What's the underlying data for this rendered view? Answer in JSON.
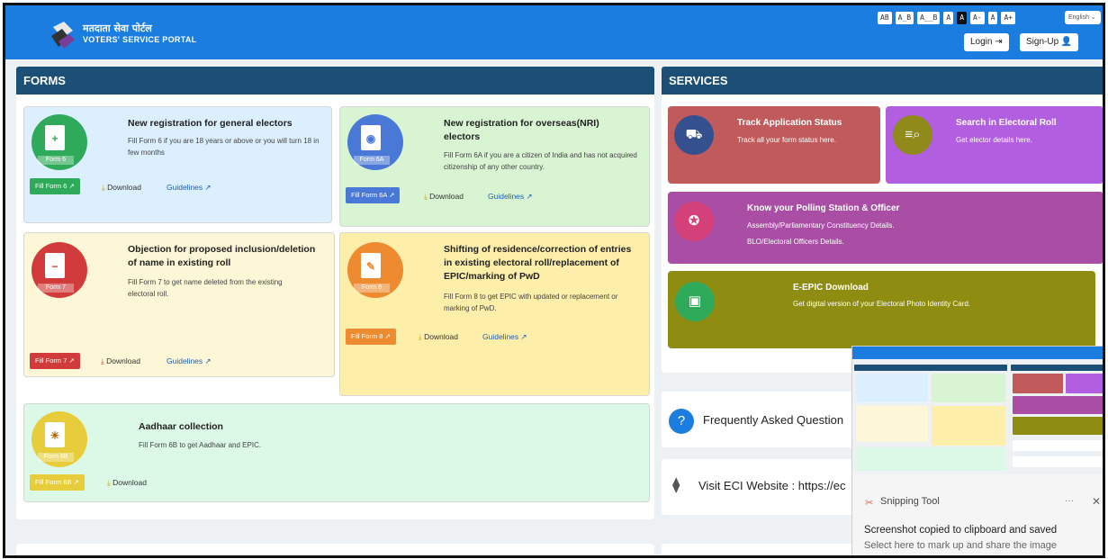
{
  "header": {
    "brand_hindi": "मतदाता सेवा पोर्टल",
    "brand_english": "VOTERS' SERVICE PORTAL",
    "a11y_buttons": [
      "AB",
      "A_B",
      "A__B",
      "A",
      "A",
      "A-",
      "A",
      "A+"
    ],
    "language": "English",
    "login_label": "Login",
    "signup_label": "Sign-Up"
  },
  "forms": {
    "title": "FORMS",
    "cards": [
      {
        "tag": "Form 6",
        "title": "New registration for general electors",
        "desc": "Fill Form 6 if you are 18 years or above or you will turn 18 in few months",
        "fill": "Fill Form 6",
        "download": "Download",
        "guidelines": "Guidelines"
      },
      {
        "tag": "Form 6A",
        "title": "New registration for overseas(NRI) electors",
        "desc": "Fill Form 6A if you are a citizen of India and has not acquired citizenship of any other country.",
        "fill": "Fill Form 6A",
        "download": "Download",
        "guidelines": "Guidelines"
      },
      {
        "tag": "Form 7",
        "title": "Objection for proposed inclusion/deletion of name in existing roll",
        "desc": "Fill Form 7 to get name deleted from the existing electoral roll.",
        "fill": "Fill Form 7",
        "download": "Download",
        "guidelines": "Guidelines"
      },
      {
        "tag": "Form 8",
        "title": "Shifting of residence/correction of entries in existing electoral roll/replacement of EPIC/marking of PwD",
        "desc": "Fill Form 8 to get EPIC with updated or replacement or marking of PwD.",
        "fill": "Fill Form 8",
        "download": "Download",
        "guidelines": "Guidelines"
      },
      {
        "tag": "Form 6B",
        "title": "Aadhaar collection",
        "desc": "Fill Form 6B to get Aadhaar and EPIC.",
        "fill": "Fill Form 6B",
        "download": "Download"
      }
    ]
  },
  "services": {
    "title": "SERVICES",
    "items": [
      {
        "title": "Track Application Status",
        "desc": "Track all your form status here."
      },
      {
        "title": "Search in Electoral Roll",
        "desc": "Get elector details here."
      },
      {
        "title": "Know your Polling Station & Officer",
        "desc": "Assembly/Parliamentary Constituency Details.",
        "desc2": "BLO/Electoral Officers Details."
      },
      {
        "title": "E-EPIC Download",
        "desc": "Get digital version of your Electoral Photo Identity Card."
      }
    ],
    "faq": "Frequently Asked Question",
    "eci": "Visit ECI Website : https://ec"
  },
  "snipping_tool": {
    "app_name": "Snipping Tool",
    "more": "···",
    "message": "Screenshot copied to clipboard and saved",
    "sub_message": "Select here to mark up and share the image"
  }
}
